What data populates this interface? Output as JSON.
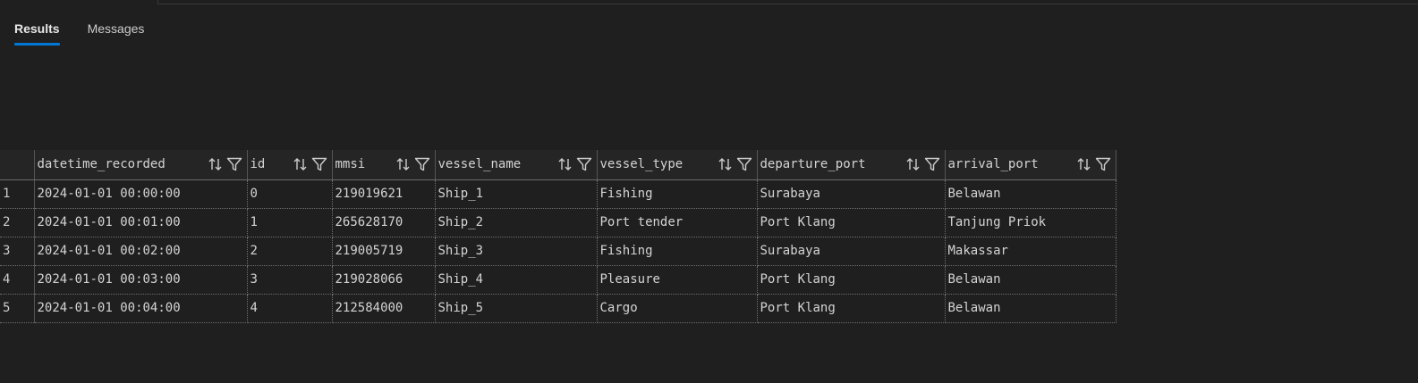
{
  "tabs": [
    {
      "label": "Results",
      "active": true
    },
    {
      "label": "Messages",
      "active": false
    }
  ],
  "accent_color": "#0078d4",
  "columns": [
    {
      "name": "datetime_recorded",
      "width": 238
    },
    {
      "name": "id",
      "width": 95
    },
    {
      "name": "mmsi",
      "width": 115
    },
    {
      "name": "vessel_name",
      "width": 181
    },
    {
      "name": "vessel_type",
      "width": 179
    },
    {
      "name": "departure_port",
      "width": 210
    },
    {
      "name": "arrival_port",
      "width": 191
    }
  ],
  "header_icons": [
    "sort-icon",
    "filter-icon"
  ],
  "rows": [
    {
      "num": "1",
      "cells": [
        "2024-01-01 00:00:00",
        "0",
        "219019621",
        "Ship_1",
        "Fishing",
        "Surabaya",
        "Belawan"
      ]
    },
    {
      "num": "2",
      "cells": [
        "2024-01-01 00:01:00",
        "1",
        "265628170",
        "Ship_2",
        "Port tender",
        "Port Klang",
        "Tanjung Priok"
      ]
    },
    {
      "num": "3",
      "cells": [
        "2024-01-01 00:02:00",
        "2",
        "219005719",
        "Ship_3",
        "Fishing",
        "Surabaya",
        "Makassar"
      ]
    },
    {
      "num": "4",
      "cells": [
        "2024-01-01 00:03:00",
        "3",
        "219028066",
        "Ship_4",
        "Pleasure",
        "Port Klang",
        "Belawan"
      ]
    },
    {
      "num": "5",
      "cells": [
        "2024-01-01 00:04:00",
        "4",
        "212584000",
        "Ship_5",
        "Cargo",
        "Port Klang",
        "Belawan"
      ]
    }
  ]
}
